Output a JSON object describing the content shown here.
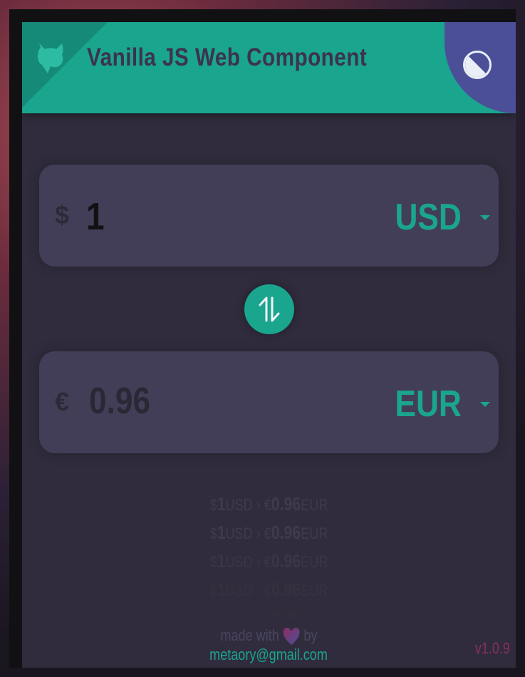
{
  "header": {
    "title": "Vanilla JS Web Component",
    "github_icon": "github-octocat-icon",
    "theme_icon": "contrast-icon"
  },
  "converter": {
    "from": {
      "symbol": "$",
      "amount": "1",
      "currency": "USD"
    },
    "to": {
      "symbol": "€",
      "amount": "0.96",
      "currency": "EUR"
    },
    "swap_icon": "swap-arrows-icon"
  },
  "history": [
    {
      "from_symbol": "$",
      "from_amount": "1",
      "from_code": "USD",
      "sep": "›",
      "to_symbol": "€",
      "to_amount": "0.96",
      "to_code": "EUR"
    },
    {
      "from_symbol": "$",
      "from_amount": "1",
      "from_code": "USD",
      "sep": "›",
      "to_symbol": "€",
      "to_amount": "0.96",
      "to_code": "EUR"
    },
    {
      "from_symbol": "$",
      "from_amount": "1",
      "from_code": "USD",
      "sep": "›",
      "to_symbol": "€",
      "to_amount": "0.96",
      "to_code": "EUR"
    },
    {
      "from_symbol": "$",
      "from_amount": "1",
      "from_code": "USD",
      "sep": "›",
      "to_symbol": "€",
      "to_amount": "0.96",
      "to_code": "EUR"
    },
    {
      "from_symbol": "$",
      "from_amount": "1",
      "from_code": "USD",
      "sep": "›",
      "to_symbol": "€",
      "to_amount": "0.96",
      "to_code": "EUR"
    }
  ],
  "footer": {
    "made_with": "made with",
    "by": "by",
    "email": "metaory@gmail.com",
    "version": "v1.0.9"
  },
  "colors": {
    "accent": "#1aa58f",
    "theme_toggle": "#4b4f98",
    "card": "#302c3d",
    "field": "#433e57",
    "version": "#8a2e62"
  }
}
